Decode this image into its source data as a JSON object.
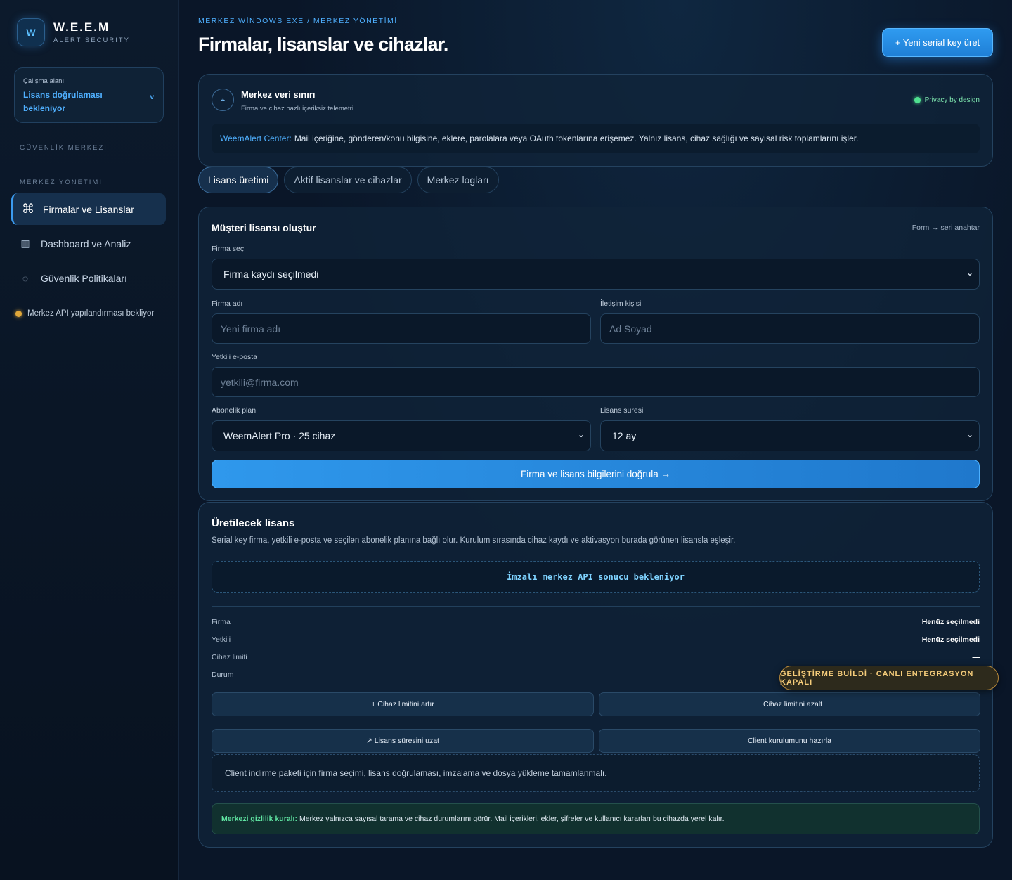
{
  "brand": {
    "title": "W.E.E.M",
    "subtitle": "ALERT SECURITY",
    "logo_letter": "W"
  },
  "workspace": {
    "label": "Çalışma alanı",
    "value": "Lisans doğrulaması bekleniyor",
    "chevron": "v"
  },
  "nav": {
    "section1": "GÜVENLİK MERKEZİ",
    "section2": "MERKEZ YÖNETİMİ",
    "items": [
      {
        "label": "Firmalar ve Lisanslar",
        "icon": "⌘",
        "icon_name": "command-icon",
        "active": true
      },
      {
        "label": "Dashboard ve Analiz",
        "icon": "▥",
        "icon_name": "chart-icon",
        "active": false
      },
      {
        "label": "Güvenlik Politikaları",
        "icon": "◌",
        "icon_name": "shield-icon",
        "active": false
      }
    ],
    "api_status": "Merkez API yapılandırması bekliyor"
  },
  "header": {
    "breadcrumb": "MERKEZ WİNDOWS EXE / MERKEZ YÖNETİMİ",
    "title": "Firmalar, lisanslar ve cihazlar.",
    "new_button": "+ Yeni serial key üret"
  },
  "limit_card": {
    "icon": "⌁",
    "title": "Merkez veri sınırı",
    "subtitle": "Firma ve cihaz bazlı içeriksiz telemetri",
    "privacy": "Privacy by design",
    "note_label": "WeemAlert Center:",
    "note_text": "Mail içeriğine, gönderen/konu bilgisine, eklere, parolalara veya OAuth tokenlarına erişemez. Yalnız lisans, cihaz sağlığı ve sayısal risk toplamlarını işler."
  },
  "tabs": [
    {
      "label": "Lisans üretimi",
      "active": true
    },
    {
      "label": "Aktif lisanslar ve cihazlar",
      "active": false
    },
    {
      "label": "Merkez logları",
      "active": false
    }
  ],
  "form": {
    "title": "Müşteri lisansı oluştur",
    "hint": "Form → seri anahtar",
    "company_select_label": "Firma seç",
    "company_select_value": "Firma kaydı seçilmedi",
    "company_name_label": "Firma adı",
    "company_name_placeholder": "Yeni firma adı",
    "contact_label": "İletişim kişisi",
    "contact_placeholder": "Ad Soyad",
    "email_label": "Yetkili e-posta",
    "email_placeholder": "yetkili@firma.com",
    "plan_label": "Abonelik planı",
    "plan_value": "WeemAlert Pro · 25 cihaz",
    "duration_label": "Lisans süresi",
    "duration_value": "12 ay",
    "verify_button": "Firma ve lisans bilgilerini doğrula →",
    "caret": "⌄"
  },
  "generated": {
    "title": "Üretilecek lisans",
    "description": "Serial key firma, yetkili e-posta ve seçilen abonelik planına bağlı olur. Kurulum sırasında cihaz kaydı ve aktivasyon burada görünen lisansla eşleşir.",
    "pending": "İmzalı merkez API sonucu bekleniyor",
    "rows": [
      {
        "key": "Firma",
        "value": "Henüz seçilmedi"
      },
      {
        "key": "Yetkili",
        "value": "Henüz seçilmedi"
      },
      {
        "key": "Cihaz limiti",
        "value": "—"
      },
      {
        "key": "Durum",
        "value": ""
      }
    ],
    "btn_increase": "+ Cihaz limitini artır",
    "btn_decrease": "− Cihaz limitini azalt",
    "btn_extend": "↗ Lisans süresini uzat",
    "btn_client": "Client kurulumunu hazırla",
    "client_note": "Client indirme paketi için firma seçimi, lisans doğrulaması, imzalama ve dosya yükleme tamamlanmalı.",
    "privacy_label": "Merkezi gizlilik kuralı:",
    "privacy_text": "Merkez yalnızca sayısal tarama ve cihaz durumlarını görür. Mail içerikleri, ekler, şifreler ve kullanıcı kararları bu cihazda yerel kalır."
  },
  "dev_badge": "GELİŞTİRME BUİLDİ · CANLI ENTEGRASYON KAPALI"
}
